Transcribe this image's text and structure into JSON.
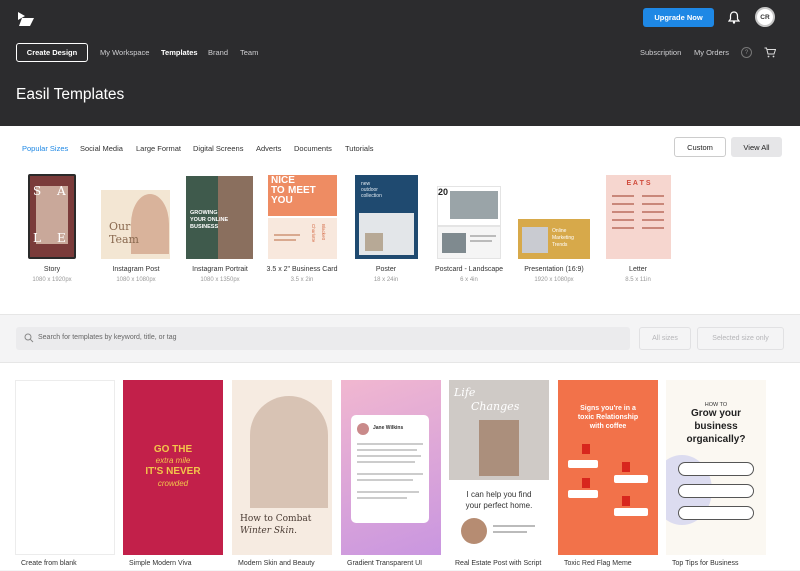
{
  "header": {
    "upgrade_label": "Upgrade Now",
    "avatar_initials": "CR",
    "create_label": "Create Design",
    "nav": [
      "My Workspace",
      "Templates",
      "Brand",
      "Team"
    ],
    "right_nav": [
      "Subscription",
      "My Orders"
    ],
    "help_glyph": "?",
    "title": "Easil Templates"
  },
  "tabs": [
    "Popular Sizes",
    "Social Media",
    "Large Format",
    "Digital Screens",
    "Adverts",
    "Documents",
    "Tutorials"
  ],
  "buttons": {
    "custom": "Custom",
    "view_all": "View All"
  },
  "sizes": [
    {
      "label": "Story",
      "dim": "1080 x 1920px",
      "thumb": [
        "S",
        "A",
        "L",
        "E"
      ]
    },
    {
      "label": "Instagram Post",
      "dim": "1080 x 1080px",
      "thumb": [
        "Our",
        "Team"
      ]
    },
    {
      "label": "Instagram Portrait",
      "dim": "1080 x 1350px",
      "thumb": [
        "GROWING",
        "YOUR ONLINE",
        "BUSINESS"
      ]
    },
    {
      "label": "3.5 x 2\" Business Card",
      "dim": "3.5 x 2in",
      "thumb": [
        "NICE",
        "TO",
        "MEET",
        "YOU",
        "Charlotte",
        "Blackett"
      ]
    },
    {
      "label": "Poster",
      "dim": "18 x 24in",
      "thumb": [
        "new",
        "outdoor",
        "collection"
      ]
    },
    {
      "label": "Postcard - Landscape",
      "dim": "6 x 4in",
      "thumb": [
        "20"
      ]
    },
    {
      "label": "Presentation (16:9)",
      "dim": "1920 x 1080px",
      "thumb": [
        "Online",
        "Marketing",
        "Trends"
      ]
    },
    {
      "label": "Letter",
      "dim": "8.5 x 11in",
      "thumb": [
        "E A T S"
      ]
    }
  ],
  "search": {
    "placeholder": "Search for templates by keyword, title, or tag",
    "all_sizes": "All sizes",
    "selected_only": "Selected size only"
  },
  "templates": [
    {
      "label": "Create from blank"
    },
    {
      "label": "Simple Modern Viva",
      "thumb": [
        "GO THE",
        "extra mile",
        "IT'S NEVER",
        "crowded"
      ]
    },
    {
      "label": "Modern Skin and Beauty",
      "thumb": [
        "How to Combat",
        "Winter Skin."
      ]
    },
    {
      "label": "Gradient Transparent UI",
      "thumb": [
        "Jane Wilkins"
      ]
    },
    {
      "label": "Real Estate Post with Script",
      "thumb": [
        "Life",
        "Changes",
        "I can help you find",
        "your perfect home."
      ]
    },
    {
      "label": "Toxic Red Flag Meme",
      "thumb": [
        "Signs you're in a",
        "toxic Relationship",
        "with coffee"
      ]
    },
    {
      "label": "Top Tips for Business",
      "thumb": [
        "HOW TO",
        "Grow your",
        "business",
        "organically?"
      ]
    }
  ]
}
